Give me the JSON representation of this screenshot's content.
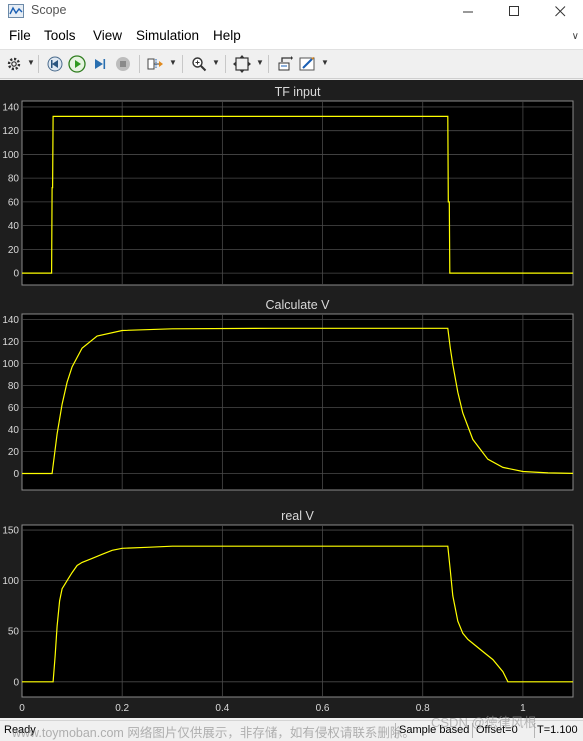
{
  "window": {
    "title": "Scope"
  },
  "menu": [
    "File",
    "Tools",
    "View",
    "Simulation",
    "Help"
  ],
  "toolbar_icons": [
    "gear-icon",
    "step-back-icon",
    "run-icon",
    "step-forward-icon",
    "stop-icon",
    "signal-select-icon",
    "zoom-icon",
    "autoscale-icon",
    "restore-layout-icon",
    "highlight-icon"
  ],
  "status": {
    "ready": "Ready",
    "mode": "Sample based",
    "offset": "Offset=0",
    "time": "T=1.100"
  },
  "watermark": {
    "left": "www.toymoban.com 网络图片仅供展示，非存储，如有侵权请联系删除。",
    "right": "CSDN @徳律风根"
  },
  "colors": {
    "plot_bg": "#000000",
    "trace": "#ffff00",
    "grid": "#4a4a4a",
    "panel_bg": "#1e1e1e"
  },
  "chart_data": [
    {
      "type": "line",
      "title": "TF input",
      "ylim": [
        -10,
        145
      ],
      "yticks": [
        "0",
        "20",
        "40",
        "60",
        "80",
        "100",
        "120",
        "140"
      ],
      "xlim": [
        0,
        1.1
      ],
      "xticks": [],
      "series": [
        {
          "x": [
            0,
            0.059,
            0.06,
            0.061,
            0.062,
            0.85,
            0.851,
            0.853,
            0.854,
            1.1
          ],
          "y": [
            0,
            0,
            72,
            72,
            132,
            132,
            60,
            60,
            0,
            0
          ]
        }
      ]
    },
    {
      "type": "line",
      "title": "Calculate V",
      "ylim": [
        -15,
        145
      ],
      "yticks": [
        "0",
        "20",
        "40",
        "60",
        "80",
        "100",
        "120",
        "140"
      ],
      "xlim": [
        0,
        1.1
      ],
      "xticks": [],
      "series": [
        {
          "x": [
            0,
            0.06,
            0.065,
            0.07,
            0.08,
            0.09,
            0.1,
            0.12,
            0.15,
            0.2,
            0.3,
            0.5,
            0.85,
            0.855,
            0.86,
            0.87,
            0.88,
            0.9,
            0.93,
            0.96,
            1.0,
            1.05,
            1.1
          ],
          "y": [
            0,
            0,
            18,
            36,
            63,
            83,
            97,
            114,
            125,
            130,
            131.5,
            132,
            132,
            114,
            99,
            74,
            55,
            31,
            13,
            5.5,
            1.8,
            0.5,
            0.1
          ]
        }
      ]
    },
    {
      "type": "line",
      "title": "real V",
      "ylim": [
        -15,
        155
      ],
      "yticks": [
        "0",
        "50",
        "100",
        "150"
      ],
      "xlim": [
        0,
        1.1
      ],
      "xticks": [
        "0",
        "0.2",
        "0.4",
        "0.6",
        "0.8",
        "1"
      ],
      "series": [
        {
          "x": [
            0,
            0.062,
            0.066,
            0.07,
            0.075,
            0.08,
            0.085,
            0.09,
            0.1,
            0.11,
            0.12,
            0.14,
            0.16,
            0.18,
            0.2,
            0.25,
            0.3,
            0.4,
            0.5,
            0.6,
            0.7,
            0.8,
            0.85,
            0.855,
            0.86,
            0.87,
            0.88,
            0.89,
            0.9,
            0.92,
            0.94,
            0.96,
            0.97,
            1.0,
            1.1
          ],
          "y": [
            0,
            0,
            25,
            55,
            80,
            92,
            96,
            100,
            108,
            115,
            118,
            122,
            126,
            130,
            132,
            133,
            134,
            134,
            134,
            134,
            134,
            134,
            134,
            110,
            85,
            60,
            48,
            42,
            38,
            30,
            22,
            10,
            0,
            0,
            0
          ]
        }
      ]
    }
  ]
}
